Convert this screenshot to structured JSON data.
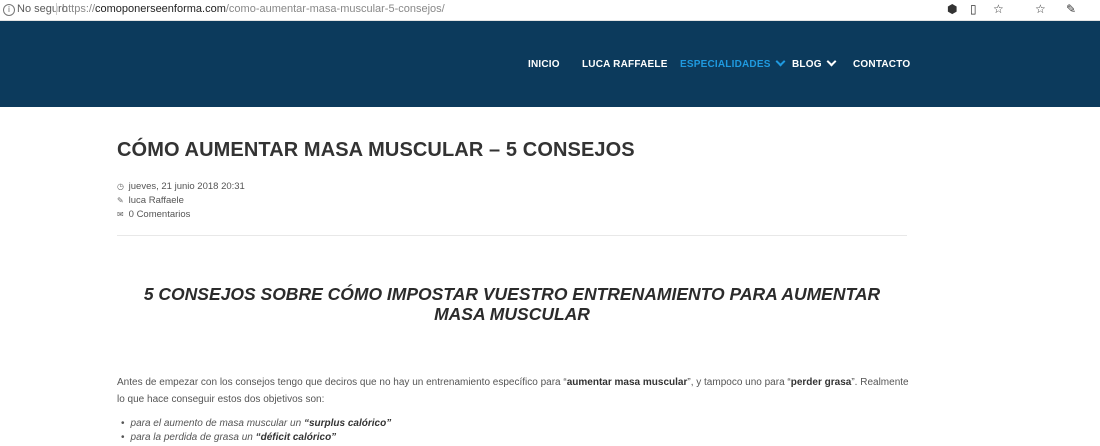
{
  "browser": {
    "security_label": "No seguro",
    "url_prefix": "https://",
    "url_host": "comoponerseenforma.com",
    "url_path": "/como-aumentar-masa-muscular-5-consejos/"
  },
  "nav": {
    "items": [
      {
        "label": "INICIO"
      },
      {
        "label": "LUCA RAFFAELE"
      },
      {
        "label": "ESPECIALIDADES"
      },
      {
        "label": "BLOG"
      },
      {
        "label": "CONTACTO"
      }
    ]
  },
  "article": {
    "title": "CÓMO AUMENTAR MASA MUSCULAR – 5 CONSEJOS",
    "date": "jueves, 21 junio 2018 20:31",
    "author": "luca Raffaele",
    "comments": "0 Comentarios",
    "subtitle": "5 CONSEJOS SOBRE CÓMO IMPOSTAR VUESTRO ENTRENAMIENTO PARA AUMENTAR MASA MUSCULAR",
    "intro_1": "Antes de empezar con los consejos tengo que deciros que no hay un entrenamiento específico para “",
    "intro_b1": "aumentar masa muscular",
    "intro_2": "”, y tampoco uno para “",
    "intro_b2": "perder grasa",
    "intro_3": "”. Realmente lo que hace conseguir estos dos objetivos son:",
    "list": [
      {
        "text": "para el aumento de masa muscular un ",
        "bold": "“surplus calórico”"
      },
      {
        "text": "para la perdida de grasa un ",
        "bold": "“déficit calórico”"
      }
    ]
  },
  "colors": {
    "header_bg": "#0c3a5c",
    "nav_active": "#1f9ae0"
  }
}
